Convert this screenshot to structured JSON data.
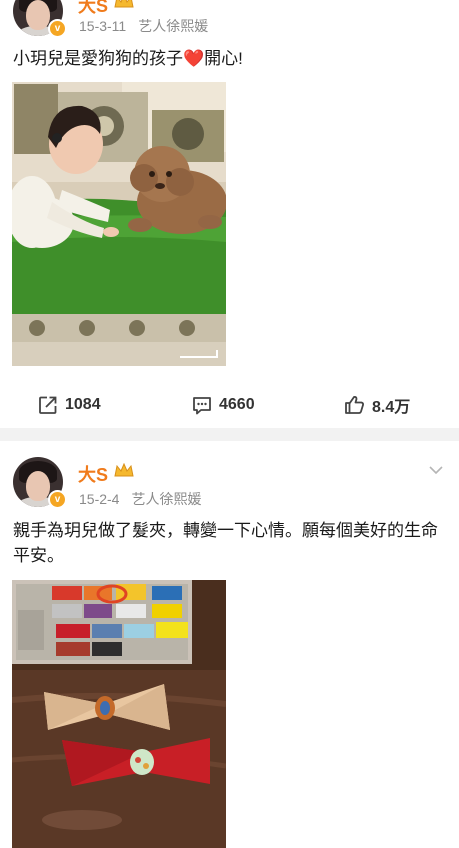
{
  "posts": [
    {
      "username": "大S",
      "date": "15-3-11",
      "source": "艺人徐熙媛",
      "text_before": "小玥兒是愛狗狗的孩子",
      "heart": "❤️",
      "text_after": "開心!",
      "repost_count": "1084",
      "comment_count": "4660",
      "like_count": "8.4万"
    },
    {
      "username": "大S",
      "date": "15-2-4",
      "source": "艺人徐熙媛",
      "text": "親手為玥兒做了髮夾，轉變一下心情。願每個美好的生命平安。"
    }
  ],
  "colors": {
    "username": "#f07b1c",
    "verified": "#f5a623",
    "meta": "#8a8a8a",
    "divider": "#f2f2f2"
  },
  "icons": [
    "verified-badge-icon",
    "crown-icon",
    "chevron-down-icon",
    "repost-icon",
    "comment-icon",
    "like-icon"
  ]
}
